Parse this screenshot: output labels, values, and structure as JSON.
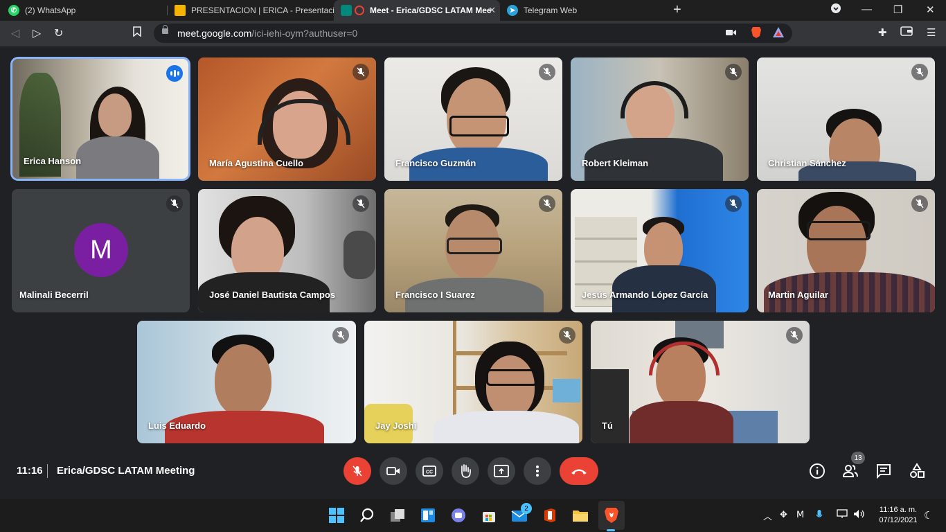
{
  "browser": {
    "tabs": [
      {
        "label": "(2) WhatsApp",
        "icon": "whatsapp-icon",
        "color": "#25d366"
      },
      {
        "label": "PRESENTACION | ERICA - Presentacion",
        "icon": "slides-icon",
        "color": "#f4b400"
      },
      {
        "label": "Meet - Erica/GDSC LATAM Mee",
        "icon": "meet-icon",
        "color": "#00897b",
        "active": true
      },
      {
        "label": "Telegram Web",
        "icon": "telegram-icon",
        "color": "#2aa1da"
      }
    ],
    "url_host": "meet.google.com",
    "url_path": "/ici-iehi-oym?authuser=0"
  },
  "participants": [
    {
      "name": "Erica Hanson",
      "speaking": true
    },
    {
      "name": "María Agustina Cuello"
    },
    {
      "name": "Francisco Guzmán"
    },
    {
      "name": "Robert Kleiman"
    },
    {
      "name": "Christian Sánchez"
    },
    {
      "name": "Malinali Becerril",
      "avatar_letter": "M",
      "avatar_color": "#7b1fa2"
    },
    {
      "name": "José Daniel Bautista Campos"
    },
    {
      "name": "Francisco I Suarez"
    },
    {
      "name": "Jesús Armando López García"
    },
    {
      "name": "Martin Aguilar"
    },
    {
      "name": "Luis Eduardo"
    },
    {
      "name": "Jay Joshi"
    },
    {
      "name": "Tú"
    }
  ],
  "meeting": {
    "time": "11:16",
    "title": "Erica/GDSC LATAM Meeting",
    "participant_count": "13"
  },
  "taskbar": {
    "mail_badge": "2",
    "clock_time": "11:16 a. m.",
    "clock_date": "07/12/2021"
  },
  "colors": {
    "meet_bg": "#202124",
    "hangup_red": "#ea4335",
    "speaking_blue": "#8ab4f8"
  }
}
